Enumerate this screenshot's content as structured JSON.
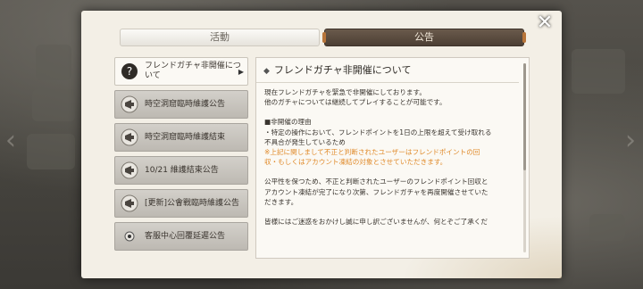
{
  "tabs": {
    "activity": "活動",
    "notice": "公告"
  },
  "notices": [
    {
      "label": "フレンドガチャ非開催について",
      "icon": "question-icon",
      "active": true
    },
    {
      "label": "時空洞窟臨時維護公告",
      "icon": "megaphone-icon",
      "active": false
    },
    {
      "label": "時空洞窟臨時維護結束",
      "icon": "megaphone-icon",
      "active": false
    },
    {
      "label": "10/21 維護結束公告",
      "icon": "megaphone-icon",
      "active": false
    },
    {
      "label": "[更新]公會戰臨時維護公告",
      "icon": "megaphone-icon",
      "active": false
    },
    {
      "label": "客服中心回覆延遲公告",
      "icon": "record-icon",
      "active": false
    }
  ],
  "detail": {
    "title": "フレンドガチャ非開催について",
    "lines": [
      {
        "text": "現在フレンドガチャを緊急で非開催にしております。",
        "warn": false
      },
      {
        "text": "他のガチャについては継続してプレイすることが可能です。",
        "warn": false
      },
      {
        "text": "",
        "warn": false
      },
      {
        "text": "■非開催の理由",
        "warn": false
      },
      {
        "text": "・特定の操作において、フレンドポイントを1日の上限を超えて受け取れる",
        "warn": false
      },
      {
        "text": "不具合が発生しているため",
        "warn": false
      },
      {
        "text": "※上記に関しまして不正と判断されたユーザーはフレンドポイントの回",
        "warn": true
      },
      {
        "text": "収・もしくはアカウント凍結の対象とさせていただきます。",
        "warn": true
      },
      {
        "text": "",
        "warn": false
      },
      {
        "text": "公平性を保つため、不正と判断されたユーザーのフレンドポイント回収と",
        "warn": false
      },
      {
        "text": "アカウント凍結が完了になり次第、フレンドガチャを再度開催させていた",
        "warn": false
      },
      {
        "text": "だきます。",
        "warn": false
      },
      {
        "text": "",
        "warn": false
      },
      {
        "text": "皆様にはご迷惑をおかけし誠に申し訳ございませんが、何とぞご了承くだ",
        "warn": false
      }
    ]
  },
  "colors": {
    "panel": "#f3efe6",
    "tab_active": "#4c3f34",
    "warning_text": "#e08a2a"
  }
}
